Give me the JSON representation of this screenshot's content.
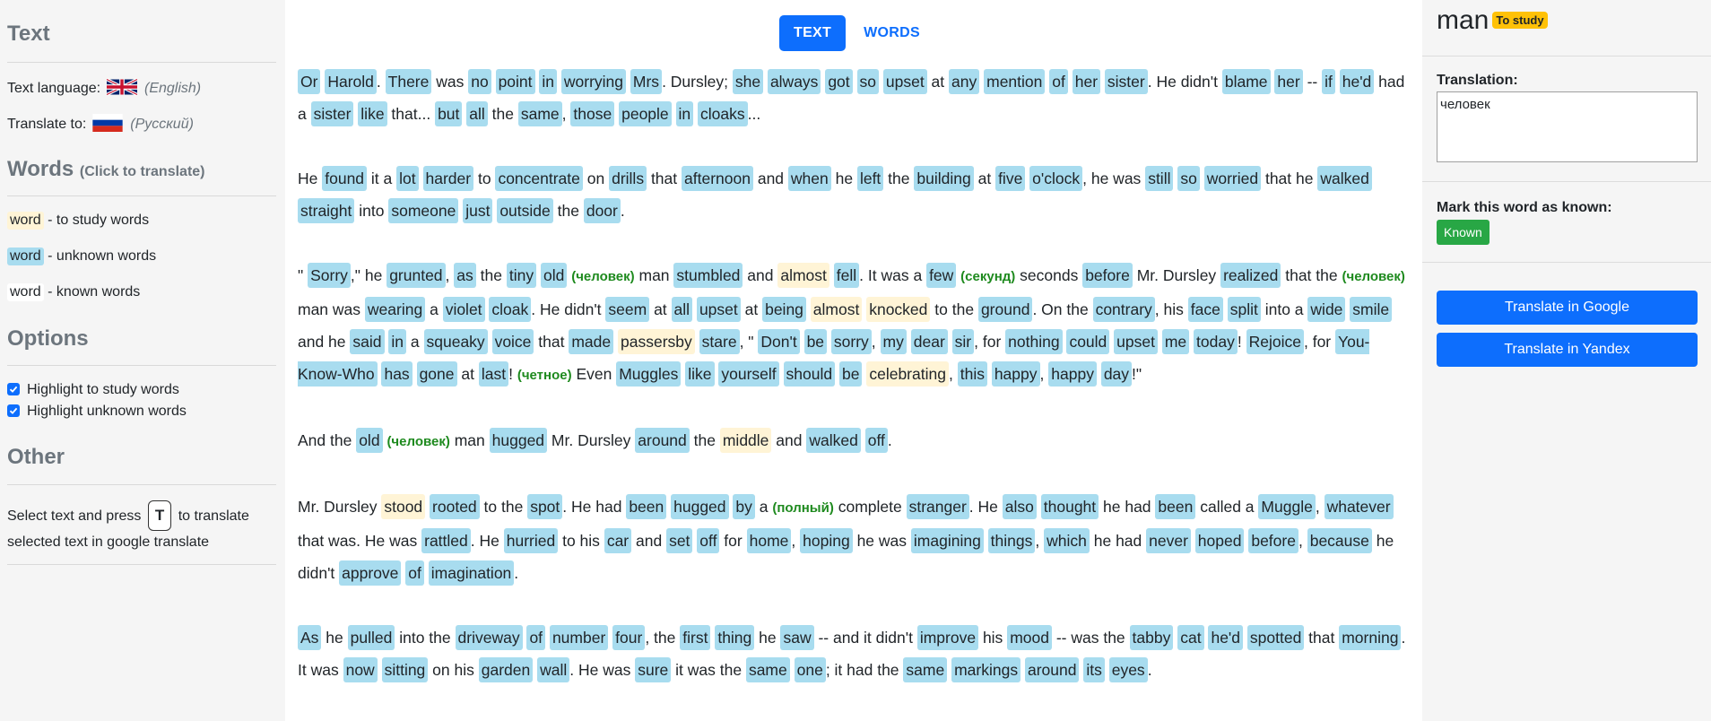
{
  "sidebar": {
    "text_title": "Text",
    "text_language_label": "Text language:",
    "text_language_name": "(English)",
    "translate_to_label": "Translate to:",
    "translate_to_name": "(Русский)",
    "words_title": "Words",
    "words_subtitle": "(Click to translate)",
    "legend": [
      {
        "word": "word",
        "desc": "- to study words"
      },
      {
        "word": "word",
        "desc": "- unknown words"
      },
      {
        "word": "word",
        "desc": "- known words"
      }
    ],
    "options_title": "Options",
    "options": [
      {
        "label": "Highlight to study words",
        "checked": true
      },
      {
        "label": "Highlight unknown words",
        "checked": true
      }
    ],
    "other_title": "Other",
    "other_text_1": "Select text and press",
    "other_key": "T",
    "other_text_2": "to translate",
    "other_text_3": "selected text in google translate"
  },
  "tabs": {
    "text": "TEXT",
    "words": "WORDS",
    "active": "TEXT"
  },
  "paragraphs": [
    [
      [
        "Or",
        "u"
      ],
      [
        "Harold",
        "u"
      ],
      ".",
      [
        "There",
        "u"
      ],
      "was",
      [
        "no",
        "u"
      ],
      [
        "point",
        "u"
      ],
      [
        "in",
        "u"
      ],
      [
        "worrying",
        "u"
      ],
      [
        "Mrs",
        "u"
      ],
      ". Dursley;",
      [
        "she",
        "u"
      ],
      [
        "always",
        "u"
      ],
      [
        "got",
        "u"
      ],
      [
        "so",
        "u"
      ],
      [
        "upset",
        "u"
      ],
      "at",
      [
        "any",
        "u"
      ],
      [
        "mention",
        "u"
      ],
      [
        "of",
        "u"
      ],
      [
        "her",
        "u"
      ],
      [
        "sister",
        "u"
      ],
      ". He didn't",
      [
        "blame",
        "u"
      ],
      [
        "her",
        "u"
      ],
      "--",
      [
        "if",
        "u"
      ],
      [
        "he'd",
        "u"
      ],
      "had a",
      [
        "sister",
        "u"
      ],
      [
        "like",
        "u"
      ],
      "that...",
      [
        "but",
        "u"
      ],
      [
        "all",
        "u"
      ],
      "the",
      [
        "same",
        "u"
      ],
      ",",
      [
        "those",
        "u"
      ],
      [
        "people",
        "u"
      ],
      [
        "in",
        "u"
      ],
      [
        "cloaks",
        "u"
      ],
      "..."
    ],
    [
      "He",
      [
        "found",
        "u"
      ],
      "it a",
      [
        "lot",
        "u"
      ],
      [
        "harder",
        "u"
      ],
      "to",
      [
        "concentrate",
        "u"
      ],
      "on",
      [
        "drills",
        "u"
      ],
      "that",
      [
        "afternoon",
        "u"
      ],
      "and",
      [
        "when",
        "u"
      ],
      "he",
      [
        "left",
        "u"
      ],
      "the",
      [
        "building",
        "u"
      ],
      "at",
      [
        "five",
        "u"
      ],
      [
        "o'clock",
        "u"
      ],
      ", he was",
      [
        "still",
        "u"
      ],
      [
        "so",
        "u"
      ],
      [
        "worried",
        "u"
      ],
      "that he",
      [
        "walked",
        "u"
      ],
      [
        "straight",
        "u"
      ],
      "into",
      [
        "someone",
        "u"
      ],
      [
        "just",
        "u"
      ],
      [
        "outside",
        "u"
      ],
      "the",
      [
        "door",
        "u"
      ],
      "."
    ],
    [
      "\"",
      [
        "Sorry",
        "u"
      ],
      ",\" he",
      [
        "grunted",
        "u"
      ],
      ",",
      [
        "as",
        "u"
      ],
      "the",
      [
        "tiny",
        "u"
      ],
      [
        "old",
        "u"
      ],
      [
        "(человек)",
        "t"
      ],
      "man",
      [
        "stumbled",
        "u"
      ],
      "and",
      [
        "almost",
        "s"
      ],
      [
        "fell",
        "u"
      ],
      ". It was a",
      [
        "few",
        "u"
      ],
      [
        "(секунд)",
        "t"
      ],
      "seconds",
      [
        "before",
        "u"
      ],
      "Mr. Dursley",
      [
        "realized",
        "u"
      ],
      "that the",
      [
        "(человек)",
        "t"
      ],
      "man was",
      [
        "wearing",
        "u"
      ],
      "a",
      [
        "violet",
        "u"
      ],
      [
        "cloak",
        "u"
      ],
      ". He didn't",
      [
        "seem",
        "u"
      ],
      "at",
      [
        "all",
        "u"
      ],
      [
        "upset",
        "u"
      ],
      "at",
      [
        "being",
        "u"
      ],
      [
        "almost",
        "s"
      ],
      [
        "knocked",
        "s"
      ],
      "to the",
      [
        "ground",
        "u"
      ],
      ". On the",
      [
        "contrary",
        "u"
      ],
      ", his",
      [
        "face",
        "u"
      ],
      [
        "split",
        "u"
      ],
      "into a",
      [
        "wide",
        "u"
      ],
      [
        "smile",
        "u"
      ],
      "and he",
      [
        "said",
        "u"
      ],
      [
        "in",
        "u"
      ],
      "a",
      [
        "squeaky",
        "u"
      ],
      [
        "voice",
        "u"
      ],
      "that",
      [
        "made",
        "u"
      ],
      [
        "passersby",
        "s"
      ],
      [
        "stare",
        "u"
      ],
      ", \"",
      [
        "Don't",
        "u"
      ],
      [
        "be",
        "u"
      ],
      [
        "sorry",
        "u"
      ],
      ",",
      [
        "my",
        "u"
      ],
      [
        "dear",
        "u"
      ],
      [
        "sir",
        "u"
      ],
      ", for",
      [
        "nothing",
        "u"
      ],
      [
        "could",
        "u"
      ],
      [
        "upset",
        "u"
      ],
      [
        "me",
        "u"
      ],
      [
        "today",
        "u"
      ],
      "!",
      [
        "Rejoice",
        "u"
      ],
      ", for",
      [
        "You-Know-Who",
        "u"
      ],
      [
        "has",
        "u"
      ],
      [
        "gone",
        "u"
      ],
      "at",
      [
        "last",
        "u"
      ],
      "!",
      [
        "(четное)",
        "t"
      ],
      "Even",
      [
        "Muggles",
        "u"
      ],
      [
        "like",
        "u"
      ],
      [
        "yourself",
        "u"
      ],
      [
        "should",
        "u"
      ],
      [
        "be",
        "u"
      ],
      [
        "celebrating",
        "s"
      ],
      ",",
      [
        "this",
        "u"
      ],
      [
        "happy",
        "u"
      ],
      ",",
      [
        "happy",
        "u"
      ],
      [
        "day",
        "u"
      ],
      "!\""
    ],
    [
      "And the",
      [
        "old",
        "u"
      ],
      [
        "(человек)",
        "t"
      ],
      "man",
      [
        "hugged",
        "u"
      ],
      "Mr. Dursley",
      [
        "around",
        "u"
      ],
      "the",
      [
        "middle",
        "s"
      ],
      "and",
      [
        "walked",
        "u"
      ],
      [
        "off",
        "u"
      ],
      "."
    ],
    [
      "Mr. Dursley",
      [
        "stood",
        "s"
      ],
      [
        "rooted",
        "u"
      ],
      "to the",
      [
        "spot",
        "u"
      ],
      ". He had",
      [
        "been",
        "u"
      ],
      [
        "hugged",
        "u"
      ],
      [
        "by",
        "u"
      ],
      "a",
      [
        "(полный)",
        "t"
      ],
      "complete",
      [
        "stranger",
        "u"
      ],
      ". He",
      [
        "also",
        "u"
      ],
      [
        "thought",
        "u"
      ],
      "he had",
      [
        "been",
        "u"
      ],
      "called a",
      [
        "Muggle",
        "u"
      ],
      ",",
      [
        "whatever",
        "u"
      ],
      "that was. He was",
      [
        "rattled",
        "u"
      ],
      ". He",
      [
        "hurried",
        "u"
      ],
      "to his",
      [
        "car",
        "u"
      ],
      "and",
      [
        "set",
        "u"
      ],
      [
        "off",
        "u"
      ],
      "for",
      [
        "home",
        "u"
      ],
      ",",
      [
        "hoping",
        "u"
      ],
      "he was",
      [
        "imagining",
        "u"
      ],
      [
        "things",
        "u"
      ],
      ",",
      [
        "which",
        "u"
      ],
      "he had",
      [
        "never",
        "u"
      ],
      [
        "hoped",
        "u"
      ],
      [
        "before",
        "u"
      ],
      ",",
      [
        "because",
        "u"
      ],
      "he didn't",
      [
        "approve",
        "u"
      ],
      [
        "of",
        "u"
      ],
      [
        "imagination",
        "u"
      ],
      "."
    ],
    [
      [
        "As",
        "u"
      ],
      "he",
      [
        "pulled",
        "u"
      ],
      "into the",
      [
        "driveway",
        "u"
      ],
      [
        "of",
        "u"
      ],
      [
        "number",
        "u"
      ],
      [
        "four",
        "u"
      ],
      ", the",
      [
        "first",
        "u"
      ],
      [
        "thing",
        "u"
      ],
      "he",
      [
        "saw",
        "u"
      ],
      "-- and it didn't",
      [
        "improve",
        "u"
      ],
      "his",
      [
        "mood",
        "u"
      ],
      "-- was the",
      [
        "tabby",
        "u"
      ],
      [
        "cat",
        "u"
      ],
      [
        "he'd",
        "u"
      ],
      [
        "spotted",
        "u"
      ],
      "that",
      [
        "morning",
        "u"
      ],
      ". It was",
      [
        "now",
        "u"
      ],
      [
        "sitting",
        "u"
      ],
      "on his",
      [
        "garden",
        "u"
      ],
      [
        "wall",
        "u"
      ],
      ". He was",
      [
        "sure",
        "u"
      ],
      "it was the",
      [
        "same",
        "u"
      ],
      [
        "one",
        "u"
      ],
      "; it had the",
      [
        "same",
        "u"
      ],
      [
        "markings",
        "u"
      ],
      [
        "around",
        "u"
      ],
      [
        "its",
        "u"
      ],
      [
        "eyes",
        "u"
      ],
      "."
    ]
  ],
  "word_panel": {
    "word": "man",
    "status_badge": "To study",
    "translation_label": "Translation:",
    "translation_value": "человек",
    "mark_known_label": "Mark this word as known:",
    "known_button": "Known",
    "google_button": "Translate in Google",
    "yandex_button": "Translate in Yandex"
  },
  "colors": {
    "unknown_highlight": "#a8dcef",
    "study_highlight": "#fff4d6",
    "accent": "#0d6efd",
    "known_button": "#28a745",
    "badge": "#ffc107",
    "translation_hint": "#1e8a1e"
  }
}
